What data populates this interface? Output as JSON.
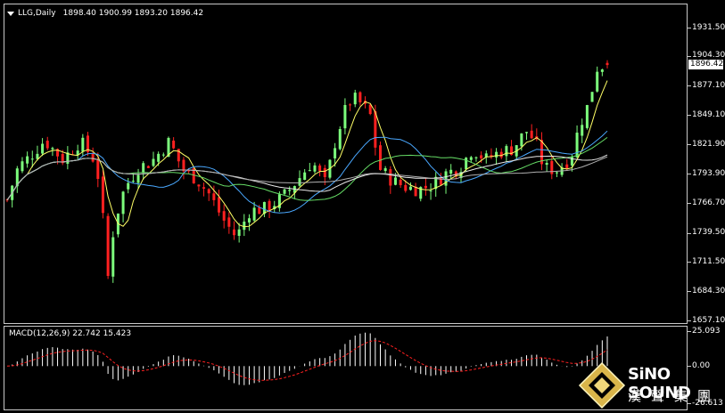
{
  "header": {
    "symbol": "LLG,Daily",
    "ohlc": "1898.40 1900.99 1893.20 1896.42"
  },
  "price_axis": {
    "labels": [
      "1931.50",
      "1904.30",
      "1877.10",
      "1849.10",
      "1821.90",
      "1793.90",
      "1766.70",
      "1739.50",
      "1711.50",
      "1684.30",
      "1657.10"
    ],
    "current_price": "1896.42"
  },
  "macd": {
    "label": "MACD(12,26,9) 22.742 15.423",
    "axis_labels": [
      "25.093",
      "0.00",
      "-26.613"
    ]
  },
  "colors": {
    "bull": "#7CFC7C",
    "bear": "#FF2020",
    "ma_yellow": "#FFFF66",
    "ma_white": "#E8E8E8",
    "ma_blue": "#4AA8FF",
    "ma_green": "#66DD66",
    "ma_gray": "#B0B0B0",
    "signal": "#FF2020",
    "grid": "#C8C8C8"
  },
  "logo": {
    "name_en": "SiNO SOUND",
    "name_cn": "漢聲集團"
  },
  "chart_data": {
    "type": "candlestick",
    "title": "LLG,Daily",
    "ylim": [
      1657.1,
      1931.5
    ],
    "last": {
      "open": 1898.4,
      "high": 1900.99,
      "low": 1893.2,
      "close": 1896.42
    },
    "macd": {
      "fast": 12,
      "slow": 26,
      "signal": 9,
      "main": 22.742,
      "signal_value": 15.423,
      "ylim": [
        -26.613,
        25.093
      ]
    }
  }
}
